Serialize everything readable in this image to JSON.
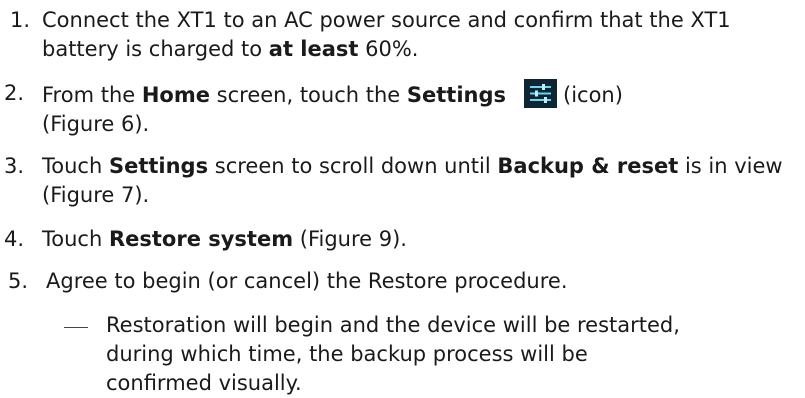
{
  "steps": [
    {
      "num": "1.",
      "parts": [
        "Connect the XT1 to an AC power source and confirm that the XT1 battery is charged to ",
        "at least",
        " 60%."
      ]
    },
    {
      "num": "2.",
      "parts": [
        "From the ",
        "Home",
        " screen, touch the ",
        "Settings",
        "(icon)",
        "(Figure 6)."
      ],
      "icon": "settings-icon"
    },
    {
      "num": "3.",
      "parts": [
        "Touch ",
        "Settings",
        " screen to scroll down until ",
        "Backup & reset",
        " is in view (Figure 7)."
      ]
    },
    {
      "num": "4.",
      "parts": [
        "Touch ",
        "Restore system",
        " (Figure 9)."
      ]
    },
    {
      "num": "5.",
      "parts": [
        "Agree to begin (or cancel) the Restore procedure."
      ]
    }
  ],
  "subitem": {
    "dash": "—",
    "lines": [
      "Restoration will begin and the device will be restarted,",
      "during which time, the backup process will be",
      "confirmed visually."
    ]
  }
}
